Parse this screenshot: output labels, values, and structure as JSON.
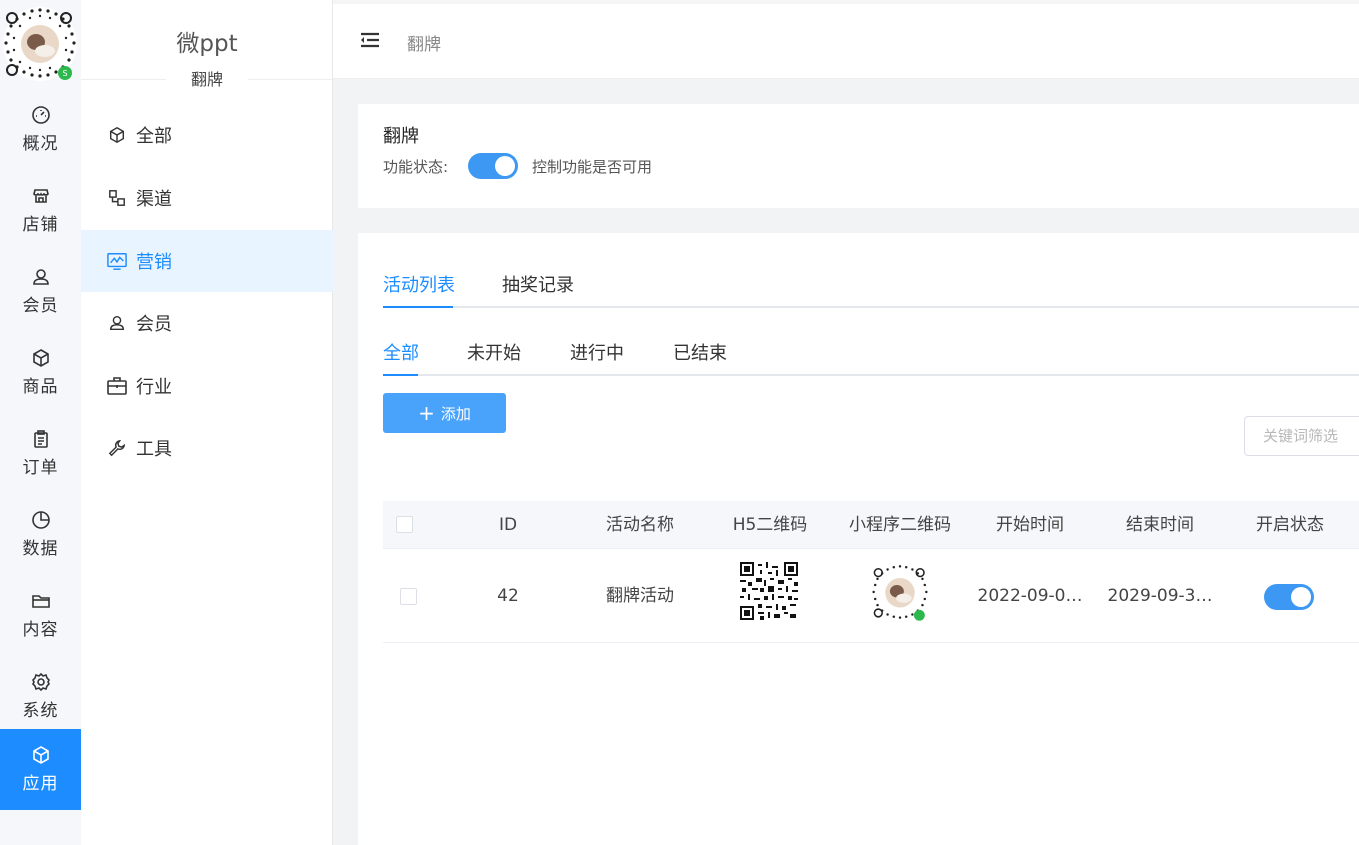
{
  "app": {
    "brand": "微ppt",
    "subtitle": "翻牌"
  },
  "rail": [
    {
      "label": "概况",
      "icon": "dashboard-icon"
    },
    {
      "label": "店铺",
      "icon": "store-icon"
    },
    {
      "label": "会员",
      "icon": "user-icon"
    },
    {
      "label": "商品",
      "icon": "box-icon"
    },
    {
      "label": "订单",
      "icon": "clipboard-icon"
    },
    {
      "label": "数据",
      "icon": "pie-icon"
    },
    {
      "label": "内容",
      "icon": "folder-icon"
    },
    {
      "label": "系统",
      "icon": "gear-icon"
    },
    {
      "label": "应用",
      "icon": "cube-icon",
      "active": true
    }
  ],
  "menu": [
    {
      "label": "全部",
      "icon": "cube-icon"
    },
    {
      "label": "渠道",
      "icon": "channel-icon"
    },
    {
      "label": "营销",
      "icon": "chart-monitor-icon",
      "active": true
    },
    {
      "label": "会员",
      "icon": "user-icon"
    },
    {
      "label": "行业",
      "icon": "briefcase-icon"
    },
    {
      "label": "工具",
      "icon": "wrench-icon"
    }
  ],
  "header": {
    "breadcrumb": "翻牌"
  },
  "feature": {
    "title": "翻牌",
    "status_label": "功能状态:",
    "status_on": true,
    "status_desc": "控制功能是否可用"
  },
  "tabs_main": [
    {
      "label": "活动列表",
      "active": true
    },
    {
      "label": "抽奖记录"
    }
  ],
  "tabs_status": [
    {
      "label": "全部",
      "active": true
    },
    {
      "label": "未开始"
    },
    {
      "label": "进行中"
    },
    {
      "label": "已结束"
    }
  ],
  "toolbar": {
    "add_label": "添加",
    "search_placeholder": "关键词筛选"
  },
  "table": {
    "columns": [
      "ID",
      "活动名称",
      "H5二维码",
      "小程序二维码",
      "开始时间",
      "结束时间",
      "开启状态"
    ],
    "rows": [
      {
        "id": "42",
        "name": "翻牌活动",
        "start": "2022-09-0…",
        "end": "2029-09-3…",
        "enabled": true
      }
    ]
  },
  "colors": {
    "accent": "#1d8cff",
    "button": "#4aa3fb",
    "switch_on": "#3c98f2"
  }
}
